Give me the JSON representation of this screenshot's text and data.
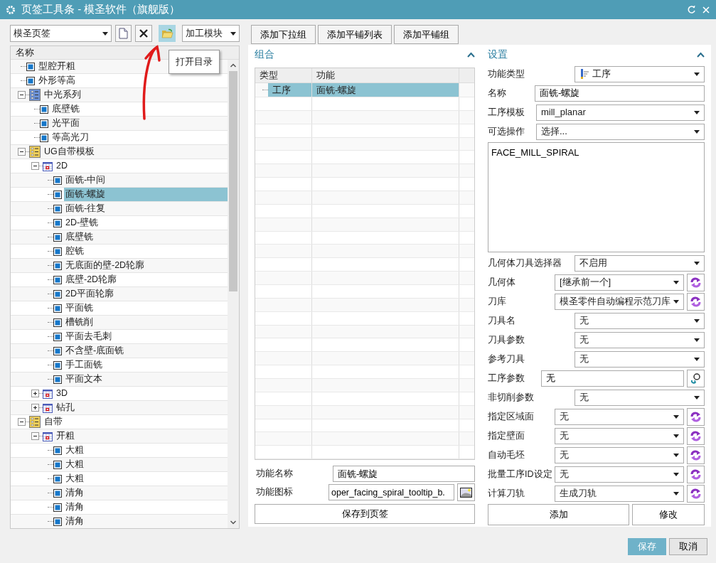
{
  "window": {
    "title": "页签工具条 - 模圣软件（旗舰版）"
  },
  "toolbar": {
    "tab_select": "模圣页签",
    "module_select": "加工模块",
    "tooltip": "打开目录"
  },
  "tree": {
    "header": "名称",
    "items": [
      {
        "kind": "op",
        "label": "型腔开粗",
        "selected": false
      },
      {
        "kind": "op",
        "label": "外形等高",
        "selected": false
      },
      {
        "kind": "folder",
        "label": "中光系列",
        "color": "#6d93d8",
        "expanded": true,
        "selected": false,
        "children": [
          {
            "kind": "op",
            "label": "底壁铣",
            "selected": false
          },
          {
            "kind": "op",
            "label": "光平面",
            "selected": false
          },
          {
            "kind": "op",
            "label": "等高光刀",
            "selected": false
          }
        ]
      },
      {
        "kind": "folder",
        "label": "UG自带模板",
        "color": "#f0cf5a",
        "expanded": true,
        "selected": false,
        "children": [
          {
            "kind": "group",
            "label": "2D",
            "expanded": true,
            "selected": false,
            "children": [
              {
                "kind": "op",
                "label": "面铣-中间",
                "selected": false
              },
              {
                "kind": "op",
                "label": "面铣-螺旋",
                "selected": true
              },
              {
                "kind": "op",
                "label": "面铣-往复",
                "selected": false
              },
              {
                "kind": "op",
                "label": "2D-壁铣",
                "selected": false
              },
              {
                "kind": "op",
                "label": "底壁铣",
                "selected": false
              },
              {
                "kind": "op",
                "label": "腔铣",
                "selected": false
              },
              {
                "kind": "op",
                "label": "无底面的壁-2D轮廓",
                "selected": false
              },
              {
                "kind": "op",
                "label": "底壁-2D轮廓",
                "selected": false
              },
              {
                "kind": "op",
                "label": "2D平面轮廓",
                "selected": false
              },
              {
                "kind": "op",
                "label": "平面铣",
                "selected": false
              },
              {
                "kind": "op",
                "label": "槽铣削",
                "selected": false
              },
              {
                "kind": "op",
                "label": "平面去毛刺",
                "selected": false
              },
              {
                "kind": "op",
                "label": "不含壁-底面铣",
                "selected": false
              },
              {
                "kind": "op",
                "label": "手工面铣",
                "selected": false
              },
              {
                "kind": "op",
                "label": "平面文本",
                "selected": false
              }
            ]
          },
          {
            "kind": "group",
            "label": "3D",
            "expanded": false,
            "selected": false
          },
          {
            "kind": "group",
            "label": "钻孔",
            "expanded": false,
            "selected": false
          }
        ]
      },
      {
        "kind": "folder",
        "label": "自带",
        "color": "#f0cf5a",
        "expanded": true,
        "selected": false,
        "children": [
          {
            "kind": "group",
            "label": "开粗",
            "expanded": true,
            "selected": false,
            "children": [
              {
                "kind": "op",
                "label": "大粗",
                "selected": false
              },
              {
                "kind": "op",
                "label": "大粗",
                "selected": false
              },
              {
                "kind": "op",
                "label": "大粗",
                "selected": false
              },
              {
                "kind": "op",
                "label": "清角",
                "selected": false
              },
              {
                "kind": "op",
                "label": "清角",
                "selected": false
              },
              {
                "kind": "op",
                "label": "清角",
                "selected": false
              }
            ]
          }
        ]
      }
    ]
  },
  "middle": {
    "buttons": [
      "添加下拉组",
      "添加平铺列表",
      "添加平铺组"
    ],
    "title": "组合",
    "columns": [
      "类型",
      "功能"
    ],
    "rows": [
      {
        "type": "工序",
        "function": "面铣-螺旋",
        "selected": true
      }
    ],
    "name_label": "功能名称",
    "name_value": "面铣-螺旋",
    "icon_label": "功能图标",
    "icon_value": "oper_facing_spiral_tooltip_b.",
    "save_button": "保存到页签"
  },
  "settings": {
    "title": "设置",
    "fields": [
      {
        "kind": "type-dropdown",
        "label": "功能类型",
        "value": "工序"
      },
      {
        "kind": "text",
        "label": "名称",
        "value": "面铣-螺旋"
      },
      {
        "kind": "combo",
        "label": "工序模板",
        "value": "mill_planar"
      },
      {
        "kind": "combo",
        "label": "可选操作",
        "value": "选择..."
      },
      {
        "kind": "area",
        "value": "FACE_MILL_SPIRAL"
      },
      {
        "kind": "dropdown",
        "label": "几何体刀具选择器",
        "value": "不启用"
      },
      {
        "kind": "linked",
        "label": "几何体",
        "value": "[继承前一个]"
      },
      {
        "kind": "linked",
        "label": "刀库",
        "value": "模圣零件自动编程示范刀库"
      },
      {
        "kind": "dropdown",
        "label": "刀具名",
        "value": "无"
      },
      {
        "kind": "dropdown",
        "label": "刀具参数",
        "value": "无"
      },
      {
        "kind": "dropdown",
        "label": "参考刀具",
        "value": "无"
      },
      {
        "kind": "lookup",
        "label": "工序参数",
        "value": "无"
      },
      {
        "kind": "dropdown",
        "label": "非切削参数",
        "value": "无"
      },
      {
        "kind": "linked",
        "label": "指定区域面",
        "value": "无"
      },
      {
        "kind": "linked",
        "label": "指定壁面",
        "value": "无"
      },
      {
        "kind": "linked",
        "label": "自动毛坯",
        "value": "无"
      },
      {
        "kind": "linked",
        "label": "批量工序ID设定",
        "value": "无"
      },
      {
        "kind": "linked",
        "label": "计算刀轨",
        "value": "生成刀轨"
      }
    ],
    "buttons": [
      "添加",
      "修改"
    ]
  },
  "footer": [
    {
      "label": "保存",
      "kind": "primary"
    },
    {
      "label": "取消",
      "kind": "default"
    }
  ]
}
